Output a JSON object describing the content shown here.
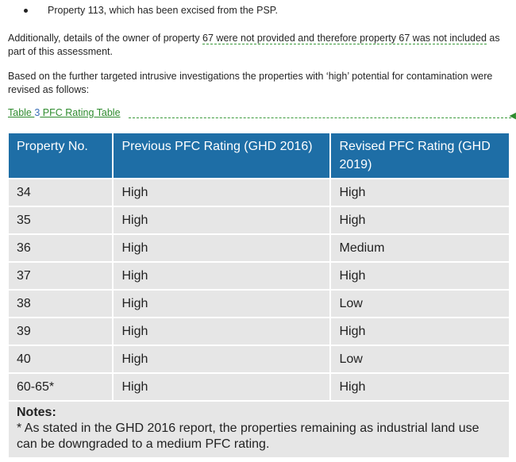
{
  "bullet": {
    "text": "Property 113, which has been excised from the PSP."
  },
  "paragraph1": {
    "before": "Additionally, details of the owner of property ",
    "tracked": "67 were not provided and therefore property 67 was not included",
    "after": " as part of this assessment."
  },
  "paragraph2": {
    "text": "Based on the further targeted intrusive investigations the properties with ‘high’ potential for contamination were revised as follows:"
  },
  "caption": {
    "label": "Table ",
    "number": "3",
    "title": " PFC Rating Table"
  },
  "table": {
    "headers": [
      "Property No.",
      "Previous PFC Rating (GHD 2016)",
      "Revised PFC Rating (GHD 2019)"
    ],
    "rows": [
      [
        "34",
        "High",
        "High"
      ],
      [
        "35",
        "High",
        "High"
      ],
      [
        "36",
        "High",
        "Medium"
      ],
      [
        "37",
        "High",
        "High"
      ],
      [
        "38",
        "High",
        "Low"
      ],
      [
        "39",
        "High",
        "High"
      ],
      [
        "40",
        "High",
        "Low"
      ],
      [
        "60-65*",
        "High",
        "High"
      ]
    ],
    "notes_title": "Notes:",
    "notes_text": "* As stated in the GHD 2016 report, the properties remaining as industrial land use can be downgraded to a medium PFC rating."
  },
  "colors": {
    "header_bg": "#1e6ea6",
    "row_bg": "#e6e6e6",
    "track_change": "#2e8b2e"
  }
}
